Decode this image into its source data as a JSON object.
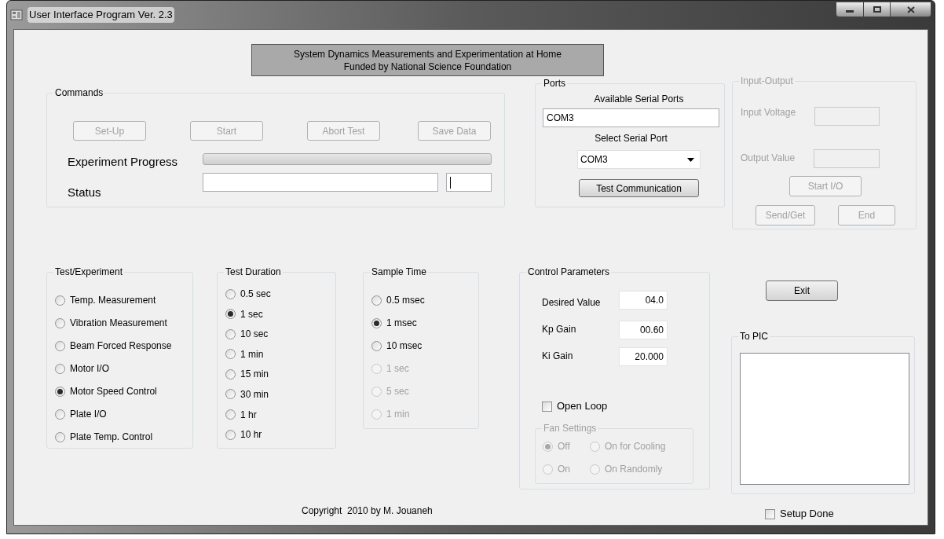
{
  "window": {
    "title": "User Interface Program Ver. 2.3"
  },
  "banner": {
    "lines": [
      "System Dynamics Measurements and Experimentation at Home",
      "Funded by National Science Foundation"
    ]
  },
  "commands": {
    "title": "Commands",
    "buttons": [
      {
        "label": "Set-Up",
        "disabled": true
      },
      {
        "label": "Start",
        "disabled": true
      },
      {
        "label": "Abort Test",
        "disabled": true
      },
      {
        "label": "Save Data",
        "disabled": true
      }
    ],
    "progress": {
      "label": "Experiment Progress",
      "level": 0
    },
    "status": {
      "label": "Status"
    }
  },
  "ports": {
    "title": "Ports",
    "available_label": "Available Serial Ports",
    "available_value": "COM3",
    "select_label": "Select Serial Port",
    "select_value": "COM3",
    "button": "Test Communication"
  },
  "input_output": {
    "title": "Input-Output",
    "disabled": true,
    "input_label": "Input Voltage",
    "output_label": "Output Value",
    "buttons": [
      "Start I/O",
      "Send/Get",
      "End"
    ]
  },
  "test_experiment": {
    "title": "Test/Experiment",
    "options": [
      {
        "label": "Temp. Measurement",
        "selected": false
      },
      {
        "label": "Vibration Measurement",
        "selected": false
      },
      {
        "label": "Beam Forced Response",
        "selected": false
      },
      {
        "label": "Motor I/O",
        "selected": false
      },
      {
        "label": "Motor Speed Control",
        "selected": true
      },
      {
        "label": "Plate I/O",
        "selected": false
      },
      {
        "label": "Plate Temp. Control",
        "selected": false
      }
    ]
  },
  "test_duration": {
    "title": "Test Duration",
    "options": [
      {
        "label": "0.5 sec",
        "selected": false
      },
      {
        "label": "1 sec",
        "selected": true
      },
      {
        "label": "10 sec",
        "selected": false
      },
      {
        "label": "1 min",
        "selected": false
      },
      {
        "label": "15 min",
        "selected": false
      },
      {
        "label": "30 min",
        "selected": false
      },
      {
        "label": "1 hr",
        "selected": false
      },
      {
        "label": "10 hr",
        "selected": false
      }
    ]
  },
  "sample_time": {
    "title": "Sample Time",
    "options": [
      {
        "label": "0.5 msec",
        "selected": false,
        "disabled": false
      },
      {
        "label": "1 msec",
        "selected": true,
        "disabled": false
      },
      {
        "label": "10 msec",
        "selected": false,
        "disabled": false
      },
      {
        "label": "1 sec",
        "selected": false,
        "disabled": true
      },
      {
        "label": "5 sec",
        "selected": false,
        "disabled": true
      },
      {
        "label": "1 min",
        "selected": false,
        "disabled": true
      }
    ]
  },
  "control_parameters": {
    "title": "Control Parameters",
    "fields": [
      {
        "label": "Desired Value",
        "value": "04.0"
      },
      {
        "label": "Kp Gain",
        "value": "00.60"
      },
      {
        "label": "Ki Gain",
        "value": "20.000"
      }
    ],
    "open_loop": {
      "label": "Open Loop",
      "checked": false
    },
    "fan_settings": {
      "title": "Fan Settings",
      "disabled": true,
      "options": [
        {
          "label": "Off",
          "selected": true
        },
        {
          "label": "On for Cooling",
          "selected": false
        },
        {
          "label": "On",
          "selected": false
        },
        {
          "label": "On Randomly",
          "selected": false
        }
      ]
    }
  },
  "exit_button": "Exit",
  "to_pic": {
    "title": "To PIC"
  },
  "setup_done": {
    "label": "Setup Done",
    "checked": false
  },
  "copyright": "Copyright  2010 by M. Jouaneh"
}
